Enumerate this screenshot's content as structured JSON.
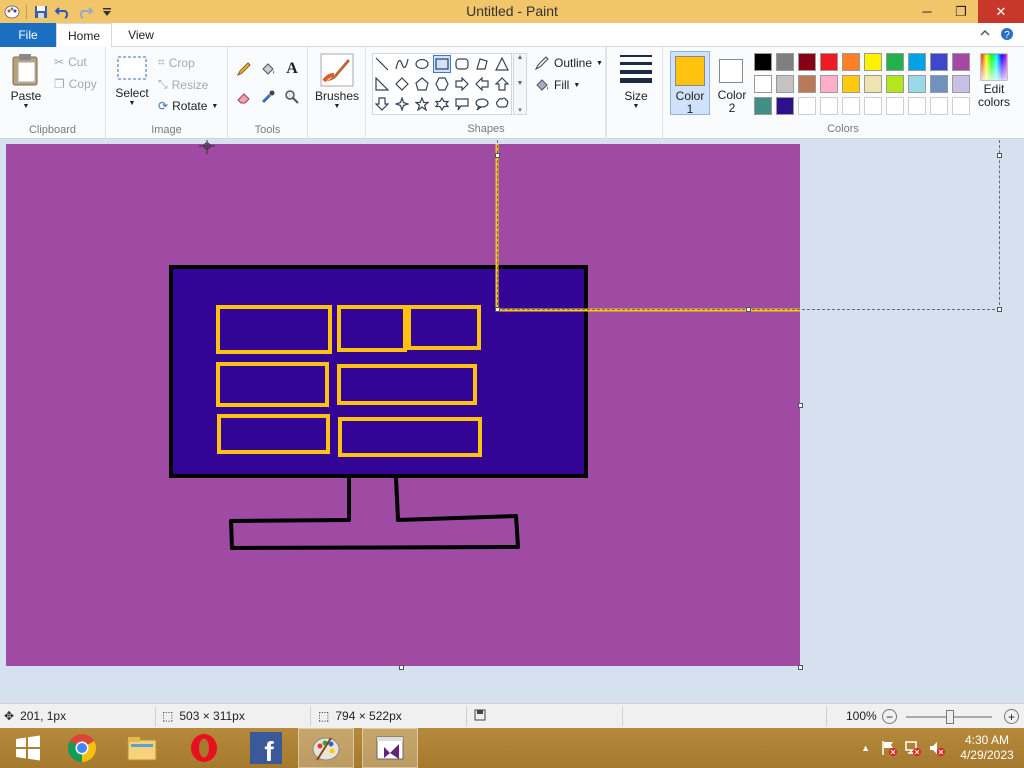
{
  "window": {
    "title": "Untitled - Paint",
    "controls": {
      "minimize": "─",
      "maximize": "❐",
      "close": "✕"
    }
  },
  "tabs": {
    "file": "File",
    "home": "Home",
    "view": "View"
  },
  "ribbon": {
    "clipboard": {
      "label": "Clipboard",
      "paste": "Paste",
      "cut": "Cut",
      "copy": "Copy"
    },
    "image": {
      "label": "Image",
      "select": "Select",
      "crop": "Crop",
      "resize": "Resize",
      "rotate": "Rotate"
    },
    "tools": {
      "label": "Tools"
    },
    "brushes": {
      "label": "Brushes"
    },
    "shapes": {
      "label": "Shapes",
      "outline": "Outline",
      "fill": "Fill"
    },
    "size": {
      "label": "Size"
    },
    "colors": {
      "label": "Colors",
      "color1_label": "Color",
      "color1_num": "1",
      "color2_label": "Color",
      "color2_num": "2",
      "edit_label": "Edit",
      "edit_label2": "colors",
      "color1": "#ffc20e",
      "color2": "#ffffff",
      "palette": [
        [
          "#000000",
          "#7f7f7f",
          "#880015",
          "#ed1c24",
          "#ff7f27",
          "#fff200",
          "#22b14c",
          "#00a2e8",
          "#3f48cc",
          "#a349a4"
        ],
        [
          "#ffffff",
          "#c3c3c3",
          "#b97a57",
          "#ffaec9",
          "#ffc90e",
          "#efe4b0",
          "#b5e61d",
          "#99d9ea",
          "#7092be",
          "#c8bfe7"
        ],
        [
          "#3f8f87",
          "#2e0f8c",
          "#ffffff",
          "#ffffff",
          "#ffffff",
          "#ffffff",
          "#ffffff",
          "#ffffff",
          "#ffffff",
          "#ffffff"
        ]
      ]
    }
  },
  "canvas": {
    "background": "#9f4aa3",
    "monitor_fill": "#330596",
    "outline_color": "#000000",
    "selection_color": "#ffc20e"
  },
  "status": {
    "cursor_pos": "201, 1px",
    "selection_size": "503 × 311px",
    "image_size": "794 × 522px",
    "zoom": "100%"
  },
  "taskbar": {
    "time": "4:30 AM",
    "date": "4/29/2023"
  }
}
